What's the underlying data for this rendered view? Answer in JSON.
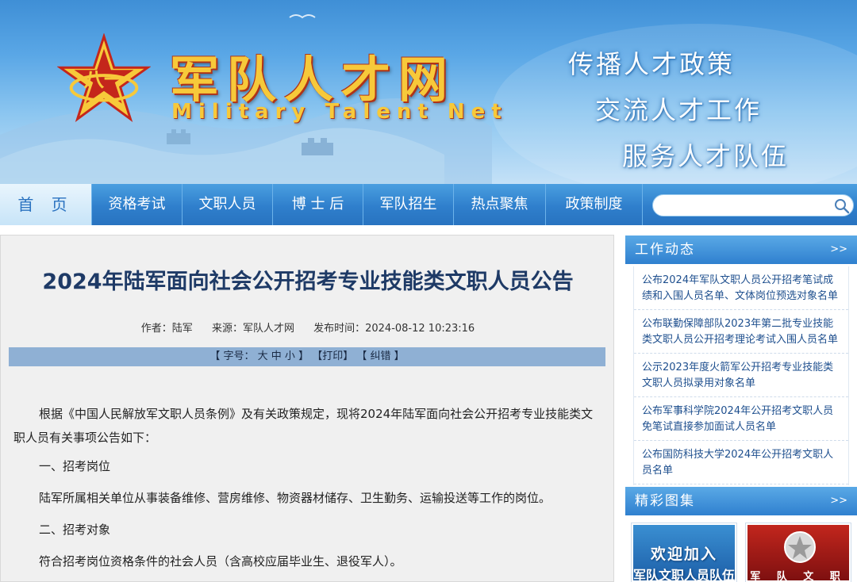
{
  "banner": {
    "title": "军队人才网",
    "subtitle": "Military Talent Net",
    "slogans": [
      "传播人才政策",
      "交流人才工作",
      "服务人才队伍"
    ]
  },
  "nav": {
    "items": [
      "首 页",
      "资格考试",
      "文职人员",
      "博 士 后",
      "军队招生",
      "热点聚焦",
      "政策制度"
    ],
    "search_placeholder": ""
  },
  "article": {
    "title": "2024年陆军面向社会公开招考专业技能类文职人员公告",
    "meta": {
      "author": "作者：陆军",
      "source": "来源：军队人才网",
      "time": "发布时间：2024-08-12 10:23:16"
    },
    "tools": {
      "font_label": "【 字号：",
      "big": "大",
      "mid": "中",
      "small": "小",
      "font_end": "】",
      "print": "【打印】",
      "correct": "【 纠错 】"
    },
    "paragraphs": {
      "intro": "根据《中国人民解放军文职人员条例》及有关政策规定，现将2024年陆军面向社会公开招考专业技能类文职人员有关事项公告如下：",
      "heading1": "一、招考岗位",
      "body1": "陆军所属相关单位从事装备维修、营房维修、物资器材储存、卫生勤务、运输投送等工作的岗位。",
      "heading2": "二、招考对象",
      "body2": "符合招考岗位资格条件的社会人员（含高校应届毕业生、退役军人）。"
    }
  },
  "sidebar": {
    "work_news": {
      "title": "工作动态",
      "more": ">>",
      "items": [
        "公布2024年军队文职人员公开招考笔试成绩和入围人员名单、文体岗位预选对象名单",
        "公布联勤保障部队2023年第二批专业技能类文职人员公开招考理论考试入围人员名单",
        "公示2023年度火箭军公开招考专业技能类文职人员拟录用对象名单",
        "公布军事科学院2024年公开招考文职人员免笔试直接参加面试人员名单",
        "公布国防科技大学2024年公开招考文职人员名单"
      ]
    },
    "gallery": {
      "title": "精彩图集",
      "more": ">>",
      "thumb1_line1": "欢迎加入",
      "thumb1_line2": "军队文职人员队伍",
      "thumb2_line1": "军 队 文 职"
    }
  },
  "colors": {
    "nav_blue": "#2f7fcc",
    "title_navy": "#1e3a66",
    "link_blue": "#1e4f8e",
    "logo_gold": "#f7c93a",
    "logo_red": "#c4261b"
  }
}
